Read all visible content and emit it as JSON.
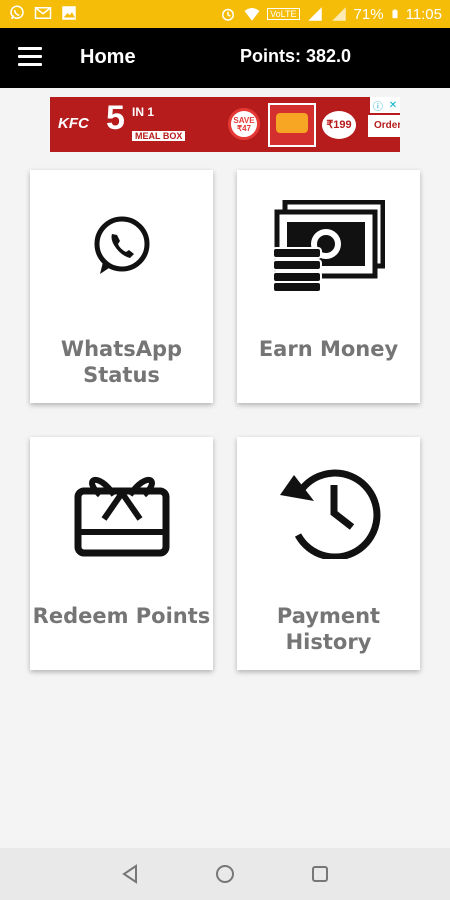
{
  "status_bar": {
    "battery": "71%",
    "time": "11:05",
    "network": "VoLTE",
    "left_icons": [
      "whatsapp-icon",
      "gmail-icon",
      "image-icon"
    ],
    "right_icons": [
      "alarm-icon",
      "wifi-icon",
      "signal-icon",
      "battery-icon"
    ],
    "background": "#f5bd08"
  },
  "app_bar": {
    "title": "Home",
    "points_label": "Points: 382.0",
    "background": "#000000"
  },
  "ad": {
    "brand": "KFC",
    "headline_num": "5",
    "headline_in1": "IN 1",
    "meal": "MEAL BOX",
    "save": "SAVE ₹47",
    "price": "₹199",
    "cta": "Order Now",
    "background": "#b71c1c"
  },
  "cards": [
    {
      "label_line1": "WhatsApp",
      "label_line2": "Status",
      "icon": "whatsapp-icon"
    },
    {
      "label_line1": "Earn Money",
      "label_line2": "",
      "icon": "money-icon"
    },
    {
      "label_line1": "Redeem Points",
      "label_line2": "",
      "icon": "gift-card-icon"
    },
    {
      "label_line1": "Payment",
      "label_line2": "History",
      "icon": "history-icon"
    }
  ],
  "nav_bar": {
    "buttons": [
      "back-icon",
      "home-icon",
      "recents-icon"
    ]
  }
}
